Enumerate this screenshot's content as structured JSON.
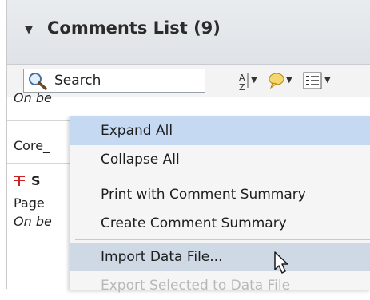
{
  "panel": {
    "title": "Comments List (9)"
  },
  "toolbar": {
    "search_placeholder": "Search"
  },
  "list": {
    "row1_fragment": "On be",
    "row2_fragment": "Core_",
    "row3_fragment": "S",
    "row4_fragment": "Page",
    "row5_fragment": "On be"
  },
  "menu": {
    "items": [
      {
        "label": "Expand All"
      },
      {
        "label": "Collapse All"
      },
      {
        "label": "Print with Comment Summary"
      },
      {
        "label": "Create Comment Summary"
      },
      {
        "label": "Import Data File..."
      },
      {
        "label": "Export Selected to Data File"
      }
    ]
  },
  "colors": {
    "highlight": "#c5daf2",
    "hover": "#cfd9e5",
    "strike_icon": "#cc2222"
  }
}
